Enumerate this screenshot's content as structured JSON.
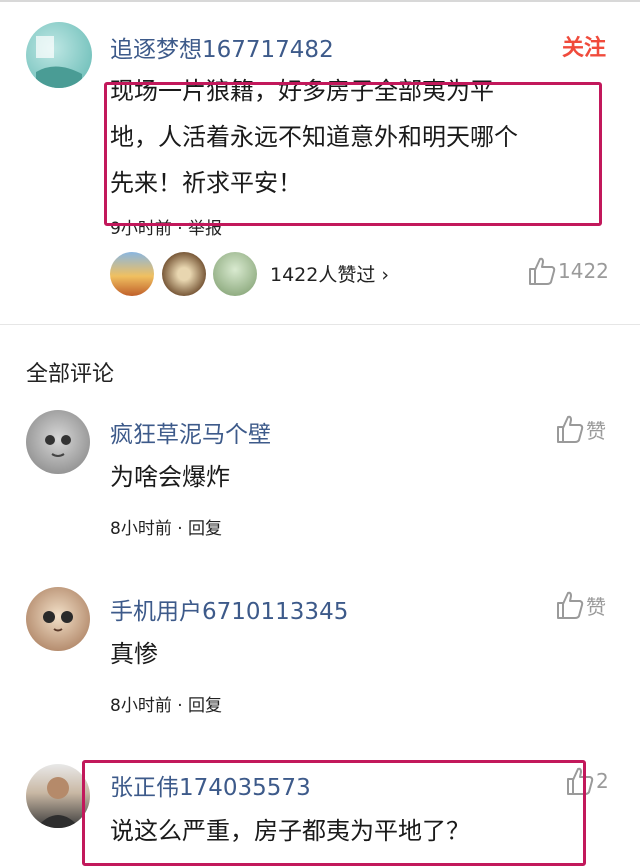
{
  "post": {
    "author": "追逐梦想167717482",
    "follow_label": "关注",
    "content_lines": [
      "现场一片狼籍，好多房子全部夷为平",
      "地，人活着永远不知道意外和明天哪个",
      "先来！祈求平安！"
    ],
    "meta": "9小时前 · 举报",
    "liked_by_text": "1422人赞过 ›",
    "like_count": "1422"
  },
  "comments_section": {
    "title": "全部评论",
    "comments": [
      {
        "author": "疯狂草泥马个壁",
        "text": "为啥会爆炸",
        "meta": "8小时前 · 回复",
        "like_label": "赞"
      },
      {
        "author": "手机用户6710113345",
        "text": "真惨",
        "meta": "8小时前 · 回复",
        "like_label": "赞"
      },
      {
        "author": "张正伟174035573",
        "text": "说这么严重，房子都夷为平地了？",
        "like_label": "2"
      }
    ]
  },
  "icons": {
    "like": "thumbs-up-icon"
  },
  "colors": {
    "username": "#3d5a8a",
    "follow": "#f04b3c",
    "highlight": "#c2185b",
    "muted": "#9a9a9a"
  }
}
